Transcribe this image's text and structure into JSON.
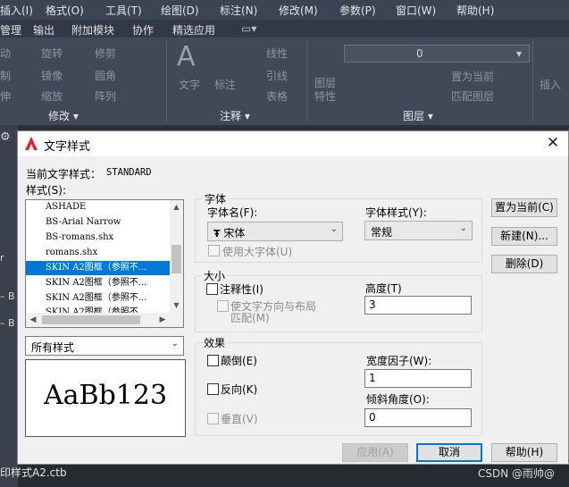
{
  "cad": {
    "menubar": [
      "插入(I)",
      "格式(O)",
      "工具(T)",
      "绘图(D)",
      "标注(N)",
      "修改(M)",
      "参数(P)",
      "窗口(W)",
      "帮助(H)"
    ],
    "ribbon_tabs": [
      "管理",
      "输出",
      "附加模块",
      "协作",
      "精选应用"
    ],
    "ribbon_panels": [
      "修改",
      "注释",
      "图层"
    ],
    "ribbon_tools": {
      "modify": [
        "旋转",
        "修剪",
        "镜像",
        "圆角",
        "缩放",
        "阵列"
      ],
      "annotate": [
        "文字",
        "标注",
        "线性",
        "引线",
        "表格"
      ],
      "layers": [
        "图层特性",
        "置为当前",
        "匹配图层"
      ],
      "insert": "插入",
      "layer_value": "0"
    },
    "bottom_file": "印样式A2.ctb",
    "watermark": "CSDN @雨帅@"
  },
  "dialog": {
    "title": "文字样式",
    "close": "✕",
    "current_style_label": "当前文字样式：",
    "current_style_value": "STANDARD",
    "styles_label": "样式(S):",
    "styles": [
      {
        "name": "ASHADE",
        "selected": false
      },
      {
        "name": "BS-Arial Narrow",
        "selected": false
      },
      {
        "name": "BS-romans.shx",
        "selected": false
      },
      {
        "name": "romans.shx",
        "selected": false
      },
      {
        "name": "SKIN A2图框（参照不...",
        "selected": true
      },
      {
        "name": "SKIN A2图框（参照不...",
        "selected": false
      },
      {
        "name": "SKIN A2图框（参照不...",
        "selected": false
      },
      {
        "name": "SKIN A2图框（参照不...",
        "selected": false
      }
    ],
    "filter": "所有样式",
    "preview": "AaBb123",
    "font_group": {
      "title": "字体",
      "font_name_label": "字体名(F):",
      "font_name_value": "宋体",
      "font_style_label": "字体样式(Y):",
      "font_style_value": "常规",
      "big_font_label": "使用大字体(U)"
    },
    "size_group": {
      "title": "大小",
      "annotative_label": "注释性(I)",
      "match_orientation_line1": "使文字方向与布局",
      "match_orientation_line2": "匹配(M)",
      "height_label": "高度(T)",
      "height_value": "3"
    },
    "effects_group": {
      "title": "效果",
      "upside_down_label": "颠倒(E)",
      "backwards_label": "反向(K)",
      "vertical_label": "垂直(V)",
      "width_factor_label": "宽度因子(W):",
      "width_factor_value": "1",
      "oblique_label": "倾斜角度(O):",
      "oblique_value": "0"
    },
    "buttons": {
      "set_current": "置为当前(C)",
      "new": "新建(N)...",
      "delete": "删除(D)",
      "apply": "应用(A)",
      "cancel": "取消",
      "help": "帮助(H)"
    }
  }
}
